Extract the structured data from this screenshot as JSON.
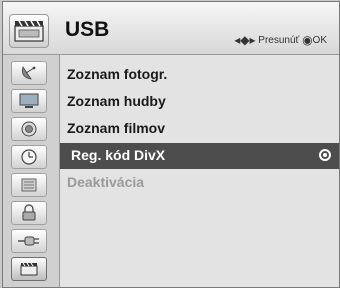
{
  "header": {
    "title": "USB",
    "hint_move": "Presunúť",
    "hint_ok": "OK",
    "icon": "clapperboard-icon"
  },
  "sidebar": {
    "items": [
      {
        "icon": "satellite-dish-icon",
        "active": false
      },
      {
        "icon": "tv-screen-icon",
        "active": false
      },
      {
        "icon": "speaker-icon",
        "active": false
      },
      {
        "icon": "clock-icon",
        "active": false
      },
      {
        "icon": "options-icon",
        "active": false
      },
      {
        "icon": "lock-icon",
        "active": false
      },
      {
        "icon": "input-plug-icon",
        "active": false
      },
      {
        "icon": "clapperboard-icon",
        "active": true
      }
    ]
  },
  "menu": {
    "items": [
      {
        "label": "Zoznam fotogr.",
        "state": "normal"
      },
      {
        "label": "Zoznam hudby",
        "state": "normal"
      },
      {
        "label": "Zoznam filmov",
        "state": "normal"
      },
      {
        "label": "Reg. kód DivX",
        "state": "selected"
      },
      {
        "label": "Deaktivácia",
        "state": "disabled"
      }
    ]
  },
  "colors": {
    "selected_bg": "#4d4d4d",
    "disabled_text": "#9a9a9a"
  }
}
